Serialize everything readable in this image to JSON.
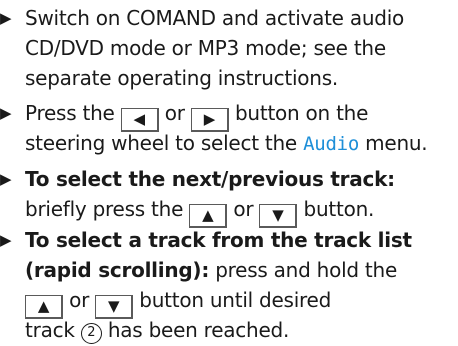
{
  "steps": [
    {
      "bullet": "▶",
      "lines": [
        "Switch on COMAND and activate audio",
        "CD/DVD mode or MP3 mode; see the",
        "separate operating instructions."
      ]
    },
    {
      "bullet": "▶",
      "line1_pre": "Press the",
      "key_left_icon": "◀",
      "or1": "or",
      "key_right_icon": "▶",
      "line1_post": "button on the",
      "line2_pre": "steering wheel to select the",
      "display_text": "Audio",
      "line2_post": "menu."
    },
    {
      "bullet": "▶",
      "bold_line": "To select the next/previous track:",
      "line2_pre": "briefly press the",
      "key_up_icon": "▲",
      "or": "or",
      "key_down_icon": "▼",
      "line2_post": "button."
    },
    {
      "bullet": "▶",
      "bold_line1": "To select a track from the track list",
      "bold_line2": "(rapid scrolling):",
      "line2_post": "press and hold the",
      "key_up_icon": "▲",
      "or": "or",
      "key_down_icon": "▼",
      "line3_post": "button until desired",
      "line4_pre": "track",
      "callout": "2",
      "line4_post": "has been reached."
    }
  ]
}
